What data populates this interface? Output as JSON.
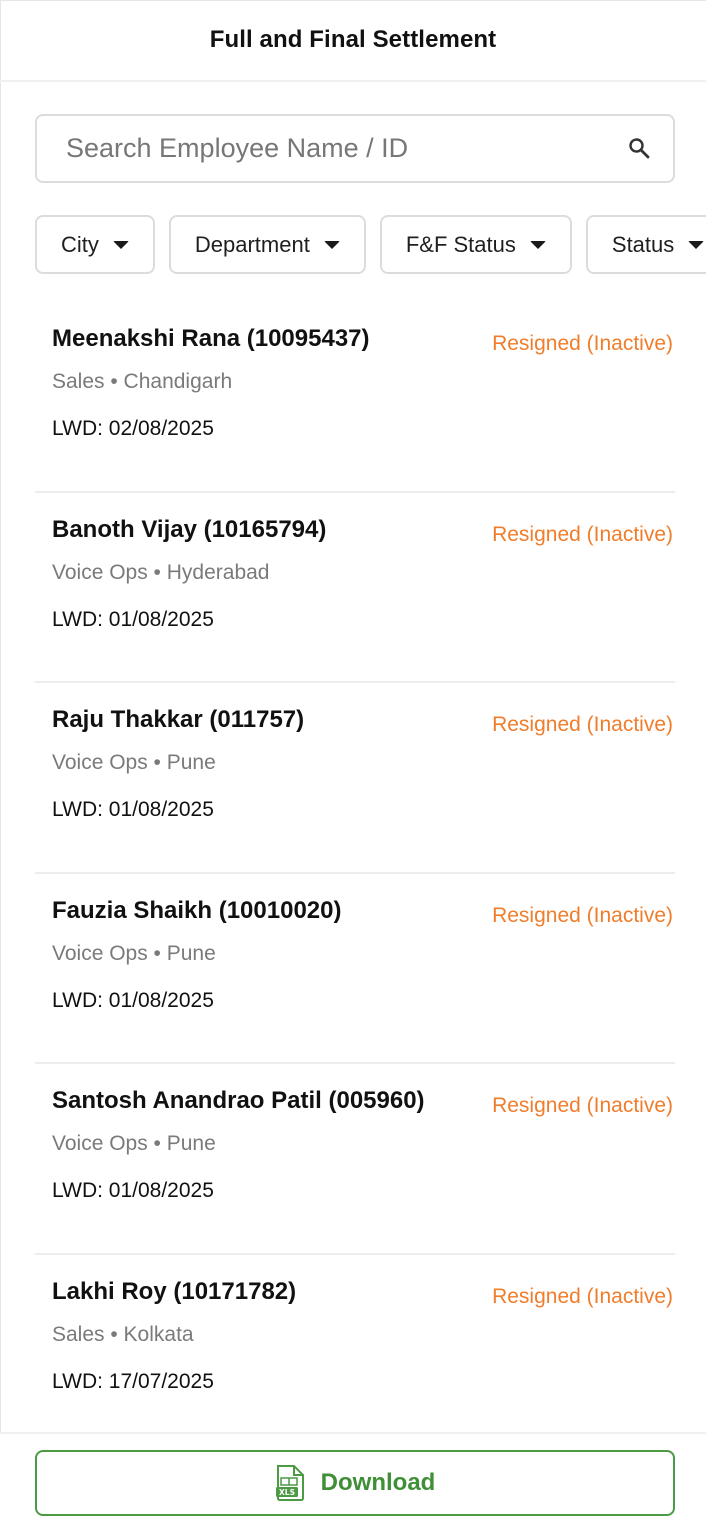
{
  "header": {
    "title": "Full and Final Settlement"
  },
  "search": {
    "placeholder": "Search Employee Name / ID",
    "value": "",
    "icon": "search-icon"
  },
  "filters": [
    {
      "label": "City"
    },
    {
      "label": "Department"
    },
    {
      "label": "F&F Status"
    },
    {
      "label": "Status"
    }
  ],
  "employees": [
    {
      "name": "Meenakshi Rana (10095437)",
      "meta": "Sales • Chandigarh",
      "lwd": "LWD: 02/08/2025",
      "status": "Resigned (Inactive)"
    },
    {
      "name": "Banoth Vijay (10165794)",
      "meta": "Voice Ops • Hyderabad",
      "lwd": "LWD: 01/08/2025",
      "status": "Resigned (Inactive)"
    },
    {
      "name": "Raju Thakkar (011757)",
      "meta": "Voice Ops • Pune",
      "lwd": "LWD: 01/08/2025",
      "status": "Resigned (Inactive)"
    },
    {
      "name": "Fauzia Shaikh (10010020)",
      "meta": "Voice Ops • Pune",
      "lwd": "LWD: 01/08/2025",
      "status": "Resigned (Inactive)"
    },
    {
      "name": "Santosh Anandrao Patil (005960)",
      "meta": "Voice Ops • Pune",
      "lwd": "LWD: 01/08/2025",
      "status": "Resigned (Inactive)"
    },
    {
      "name": "Lakhi Roy (10171782)",
      "meta": "Sales • Kolkata",
      "lwd": "LWD: 17/07/2025",
      "status": "Resigned (Inactive)"
    }
  ],
  "footer": {
    "download_label": "Download",
    "icon": "xls-file-icon",
    "icon_text": "XLS"
  },
  "colors": {
    "status": "#f07d2b",
    "download": "#3f8f37",
    "border": "#dcdcdc"
  }
}
